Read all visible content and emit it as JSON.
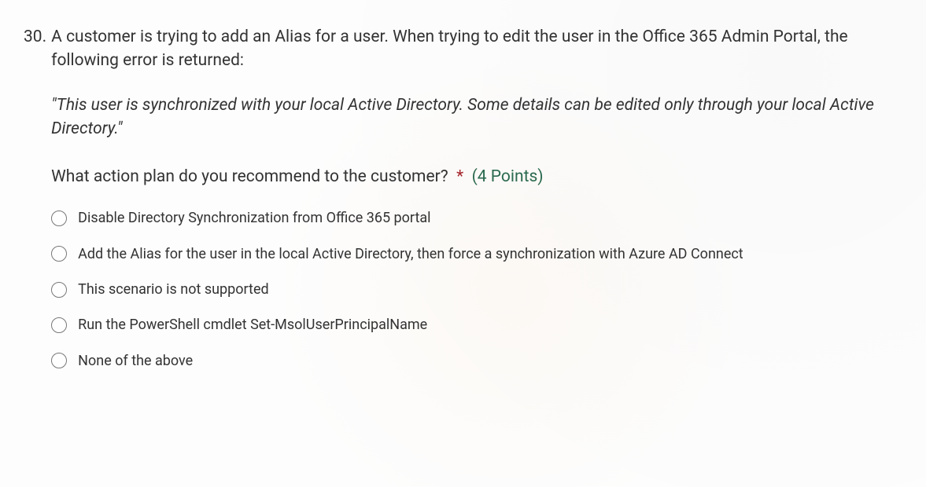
{
  "question": {
    "number": "30.",
    "stem_line1": "A customer is trying to add an Alias for a user. When trying to edit the user in the Office 365 Admin Portal, the following error is returned:",
    "quote": "\"This user is synchronized with your local Active Directory. Some details can be edited only through your local Active Directory.\"",
    "prompt": "What action plan do you recommend to the customer?",
    "required_marker": "*",
    "points": "(4 Points)"
  },
  "options": [
    {
      "label": "Disable Directory Synchronization from Office 365 portal"
    },
    {
      "label": "Add the Alias for the user in the local Active Directory, then force a synchronization with Azure AD Connect"
    },
    {
      "label": "This scenario is not supported"
    },
    {
      "label": "Run the PowerShell cmdlet Set-MsolUserPrincipalName"
    },
    {
      "label": "None of the above"
    }
  ]
}
